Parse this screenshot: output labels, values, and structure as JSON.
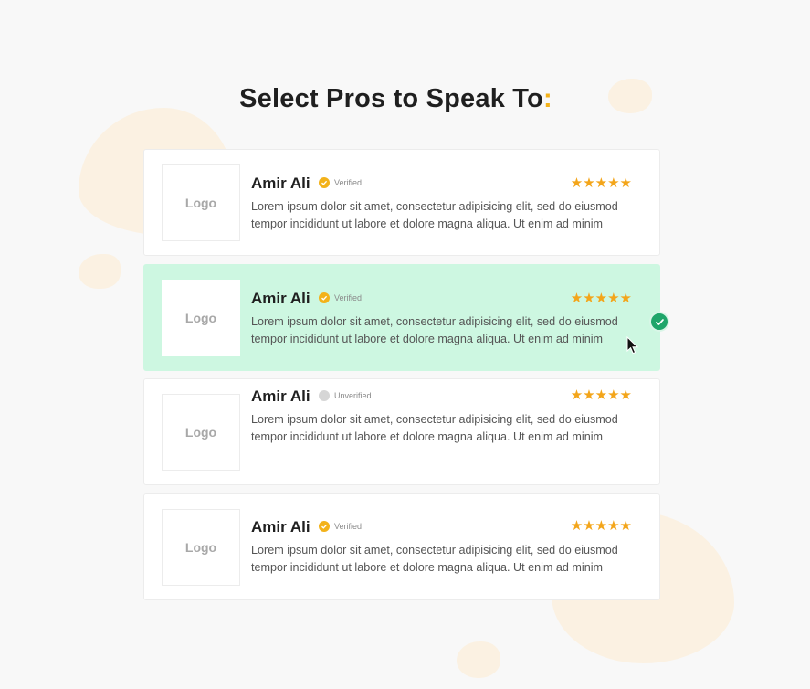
{
  "heading": {
    "text": "Select Pros to Speak To",
    "colon": ":"
  },
  "accent_color": "#f3b21a",
  "selected_color": "#cdf7e1",
  "pros": [
    {
      "logo": "Logo",
      "name": "Amir Ali",
      "status": "Verified",
      "verified": true,
      "rating": 5,
      "stars": "★★★★★",
      "description": "Lorem ipsum dolor sit amet, consectetur adipisicing elit, sed do eiusmod tempor incididunt ut labore et dolore magna aliqua. Ut enim ad minim",
      "selected": false
    },
    {
      "logo": "Logo",
      "name": "Amir Ali",
      "status": "Verified",
      "verified": true,
      "rating": 5,
      "stars": "★★★★★",
      "description": "Lorem ipsum dolor sit amet, consectetur adipisicing elit, sed do eiusmod tempor incididunt ut labore et dolore magna aliqua. Ut enim ad minim",
      "selected": true
    },
    {
      "logo": "Logo",
      "name": "Amir Ali",
      "status": "Unverified",
      "verified": false,
      "rating": 5,
      "stars": "★★★★★",
      "description": "Lorem ipsum dolor sit amet, consectetur adipisicing elit, sed do eiusmod tempor incididunt ut labore et dolore magna aliqua. Ut enim ad minim",
      "selected": false
    },
    {
      "logo": "Logo",
      "name": "Amir Ali",
      "status": "Verified",
      "verified": true,
      "rating": 5,
      "stars": "★★★★★",
      "description": "Lorem ipsum dolor sit amet, consectetur adipisicing elit, sed do eiusmod tempor incididunt ut labore et dolore magna aliqua. Ut enim ad minim",
      "selected": false
    }
  ],
  "icons": {
    "verified": "check-badge-icon",
    "selected": "check-circle-icon",
    "cursor": "mouse-pointer-icon",
    "star": "star-icon"
  }
}
